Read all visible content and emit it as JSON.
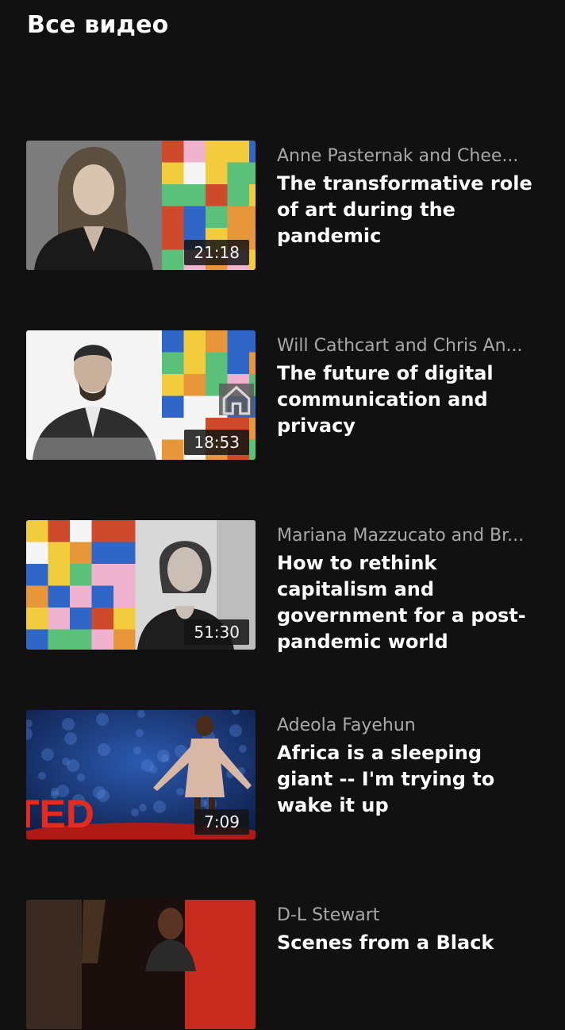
{
  "header": {
    "title": "Все видео"
  },
  "videos": [
    {
      "speaker": "Anne Pasternak and Chee...",
      "title": "The transformative role of art during the pandemic",
      "duration": "21:18"
    },
    {
      "speaker": "Will Cathcart and Chris An...",
      "title": "The future of digital communication and privacy",
      "duration": "18:53",
      "badge_icon": "home-icon"
    },
    {
      "speaker": "Mariana Mazzucato and Br...",
      "title": "How to rethink capitalism and government for a post-pandemic world",
      "duration": "51:30"
    },
    {
      "speaker": "Adeola Fayehun",
      "title": "Africa is a sleeping giant -- I'm trying to wake it up",
      "duration": "7:09",
      "stage_logo": "TED"
    },
    {
      "speaker": "D-L Stewart",
      "title": "Scenes from a Black",
      "duration": ""
    }
  ],
  "colors": {
    "background": "#111111",
    "tile_palette": [
      "#e8963a",
      "#2f66c8",
      "#cf4a2b",
      "#f2cc3d",
      "#5bc07a",
      "#f0b3cf",
      "#f5f5f5"
    ],
    "ted_red": "#e62b1e"
  }
}
